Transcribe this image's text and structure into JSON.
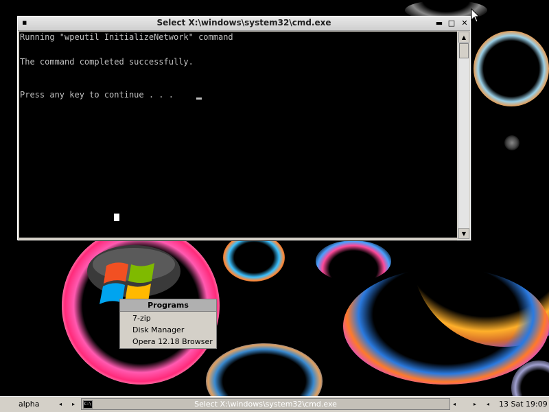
{
  "window": {
    "title": "Select X:\\windows\\system32\\cmd.exe",
    "system_menu_glyph": "▪",
    "minimize_glyph": "▬",
    "maximize_glyph": "□",
    "close_glyph": "✕"
  },
  "console": {
    "lines": [
      "Running \"wpeutil InitializeNetwork\" command",
      "The command completed successfully.",
      "Press any key to continue . . ."
    ],
    "background": "#000000",
    "text_color": "#c0c0c0"
  },
  "scrollbar": {
    "up_glyph": "▲",
    "down_glyph": "▼"
  },
  "programs_menu": {
    "title": "Programs",
    "items": [
      "7-zip",
      "Disk Manager",
      "Opera 12.18 Browser"
    ]
  },
  "taskbar": {
    "workspace": "alpha",
    "prev_glyph": "◂",
    "next_glyph": "▸",
    "task_label": "Select X:\\windows\\system32\\cmd.exe",
    "task_icon_glyph": "C:\\",
    "task_nav_left": "◂",
    "task_nav_right": "▸",
    "task_nav_left2": "◂",
    "clock": "13 Sat 19:09"
  },
  "icons": {
    "desktop_logo": "windows-logo-icon",
    "pointer": "mouse-pointer-icon"
  },
  "colors": {
    "window_frame": "#d4d0c8",
    "desktop": "#000000"
  }
}
